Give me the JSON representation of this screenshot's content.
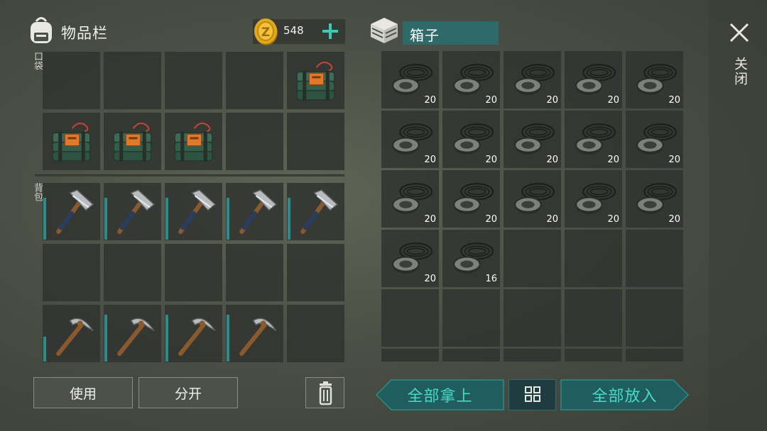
{
  "inventory": {
    "title": "物品栏",
    "pocket_label": "口袋",
    "backpack_label": "背包",
    "coins": "548",
    "pocket_slots": [
      {
        "item": "",
        "qty": ""
      },
      {
        "item": "",
        "qty": ""
      },
      {
        "item": "",
        "qty": ""
      },
      {
        "item": "",
        "qty": ""
      },
      {
        "item": "explosive-charge",
        "qty": ""
      },
      {
        "item": "explosive-charge",
        "qty": ""
      },
      {
        "item": "explosive-charge",
        "qty": ""
      },
      {
        "item": "explosive-charge",
        "qty": ""
      },
      {
        "item": "",
        "qty": ""
      },
      {
        "item": "",
        "qty": ""
      }
    ],
    "backpack_slots": [
      {
        "item": "hammer",
        "qty": "",
        "durability": 0.75
      },
      {
        "item": "hammer",
        "qty": "",
        "durability": 0.75
      },
      {
        "item": "hammer",
        "qty": "",
        "durability": 0.75
      },
      {
        "item": "hammer",
        "qty": "",
        "durability": 0.75
      },
      {
        "item": "hammer",
        "qty": "",
        "durability": 0.75
      },
      {
        "item": "",
        "qty": ""
      },
      {
        "item": "",
        "qty": ""
      },
      {
        "item": "",
        "qty": ""
      },
      {
        "item": "",
        "qty": ""
      },
      {
        "item": "",
        "qty": ""
      },
      {
        "item": "pickaxe",
        "qty": "",
        "durability": 0.45
      },
      {
        "item": "pickaxe",
        "qty": "",
        "durability": 0.85
      },
      {
        "item": "pickaxe",
        "qty": "",
        "durability": 0.85
      },
      {
        "item": "pickaxe",
        "qty": "",
        "durability": 0.85
      },
      {
        "item": "",
        "qty": ""
      }
    ]
  },
  "box": {
    "title": "箱子",
    "slots": [
      {
        "item": "rope",
        "qty": "20"
      },
      {
        "item": "rope",
        "qty": "20"
      },
      {
        "item": "rope",
        "qty": "20"
      },
      {
        "item": "rope",
        "qty": "20"
      },
      {
        "item": "rope",
        "qty": "20"
      },
      {
        "item": "rope",
        "qty": "20"
      },
      {
        "item": "rope",
        "qty": "20"
      },
      {
        "item": "rope",
        "qty": "20"
      },
      {
        "item": "rope",
        "qty": "20"
      },
      {
        "item": "rope",
        "qty": "20"
      },
      {
        "item": "rope",
        "qty": "20"
      },
      {
        "item": "rope",
        "qty": "20"
      },
      {
        "item": "rope",
        "qty": "20"
      },
      {
        "item": "rope",
        "qty": "20"
      },
      {
        "item": "rope",
        "qty": "20"
      },
      {
        "item": "rope",
        "qty": "20"
      },
      {
        "item": "rope",
        "qty": "16"
      },
      {
        "item": "",
        "qty": ""
      },
      {
        "item": "",
        "qty": ""
      },
      {
        "item": "",
        "qty": ""
      },
      {
        "item": "",
        "qty": ""
      },
      {
        "item": "",
        "qty": ""
      },
      {
        "item": "",
        "qty": ""
      },
      {
        "item": "",
        "qty": ""
      },
      {
        "item": "",
        "qty": ""
      },
      {
        "item": "",
        "qty": ""
      },
      {
        "item": "",
        "qty": ""
      },
      {
        "item": "",
        "qty": ""
      },
      {
        "item": "",
        "qty": ""
      },
      {
        "item": "",
        "qty": ""
      }
    ]
  },
  "buttons": {
    "use": "使用",
    "split": "分开",
    "take_all": "全部拿上",
    "put_all": "全部放入",
    "close": "关闭"
  },
  "colors": {
    "accent_teal": "#49d9c8",
    "box_title_bg": "#2f6a6a",
    "durability_bar": "#2b8c8c",
    "coin_gold": "#e0a820"
  },
  "icons": {
    "backpack": "backpack-icon",
    "coin": "coin-icon",
    "add": "plus-icon",
    "box": "crate-icon",
    "close": "close-icon",
    "trash": "trash-icon",
    "sort": "grid-icon"
  }
}
